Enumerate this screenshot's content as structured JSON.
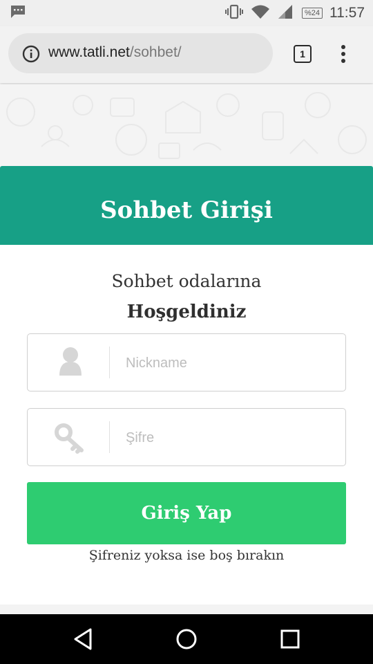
{
  "status_bar": {
    "time": "11:57",
    "battery": "%24",
    "icons": [
      "message-icon",
      "vibrate-icon",
      "wifi-icon",
      "signal-icon",
      "battery-icon"
    ]
  },
  "browser": {
    "url_host": "www.tatli.net",
    "url_path": "/sohbet/",
    "tab_count": "1"
  },
  "login": {
    "title": "Sohbet Girişi",
    "welcome_line1": "Sohbet odalarına",
    "welcome_line2": "Hoşgeldiniz",
    "nickname_placeholder": "Nickname",
    "password_placeholder": "Şifre",
    "button_label": "Giriş Yap",
    "hint": "Şifreniz yoksa ise boş bırakın",
    "header_color": "#17a086",
    "button_color": "#2ecc71"
  },
  "nav_bar": {
    "icons": [
      "back-icon",
      "home-icon",
      "recents-icon"
    ]
  }
}
